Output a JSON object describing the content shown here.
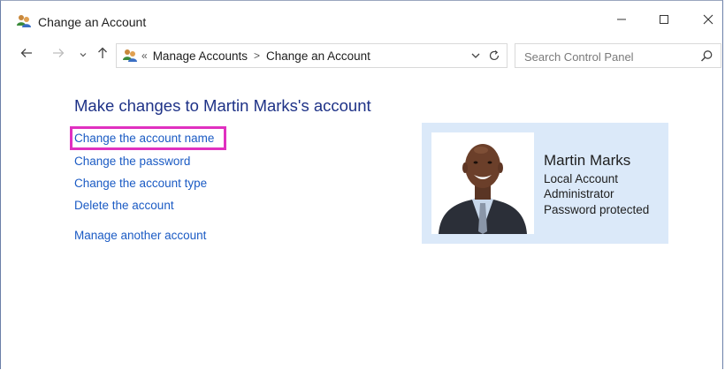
{
  "window": {
    "title": "Change an Account"
  },
  "address_bar": {
    "overflow_marker": "«",
    "segments": [
      "Manage Accounts",
      "Change an Account"
    ],
    "separator": ">"
  },
  "search": {
    "placeholder": "Search Control Panel"
  },
  "content": {
    "heading": "Make changes to Martin Marks's account",
    "links": [
      "Change the account name",
      "Change the password",
      "Change the account type",
      "Delete the account",
      "Manage another account"
    ]
  },
  "account": {
    "name": "Martin Marks",
    "type": "Local Account",
    "role": "Administrator",
    "status": "Password protected"
  },
  "colors": {
    "link": "#1b5bc4",
    "heading": "#1e3287",
    "highlight": "#e030c0",
    "card_background": "#dbe9f9"
  },
  "icons": {
    "app": "users-icon",
    "minimize": "minimize-icon",
    "maximize": "maximize-icon",
    "close": "close-icon",
    "back": "back-arrow-icon",
    "forward": "forward-arrow-icon",
    "recent": "chevron-down-icon",
    "up": "up-arrow-icon",
    "refresh": "refresh-icon",
    "search": "search-icon"
  }
}
